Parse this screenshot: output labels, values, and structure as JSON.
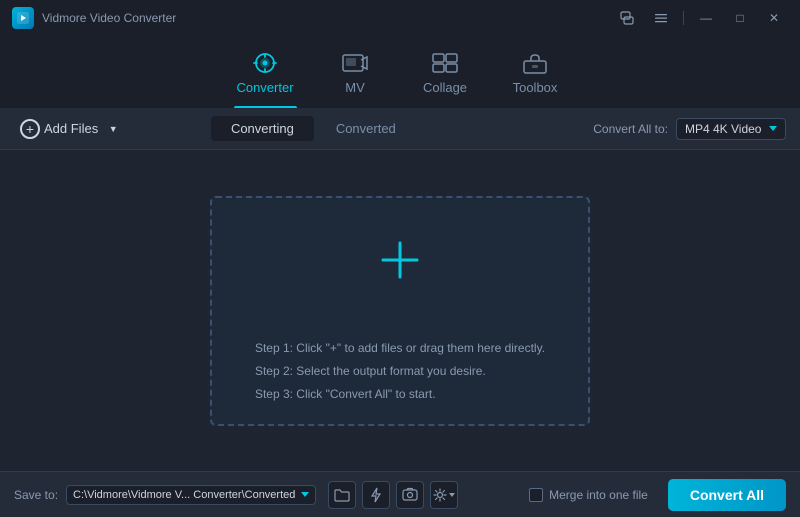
{
  "app": {
    "title": "Vidmore Video Converter",
    "logo_alt": "app-logo"
  },
  "title_bar": {
    "controls": {
      "chat_label": "💬",
      "menu_label": "≡",
      "separator": "|",
      "minimize_label": "—",
      "maximize_label": "□",
      "close_label": "✕"
    }
  },
  "nav": {
    "tabs": [
      {
        "id": "converter",
        "label": "Converter",
        "active": true
      },
      {
        "id": "mv",
        "label": "MV",
        "active": false
      },
      {
        "id": "collage",
        "label": "Collage",
        "active": false
      },
      {
        "id": "toolbox",
        "label": "Toolbox",
        "active": false
      }
    ]
  },
  "toolbar": {
    "add_files_label": "Add Files",
    "converting_tab": "Converting",
    "converted_tab": "Converted",
    "convert_all_to_label": "Convert All to:",
    "format_value": "MP4 4K Video"
  },
  "drop_zone": {
    "plus_icon": "+",
    "instructions": [
      "Step 1: Click \"+\" to add files or drag them here directly.",
      "Step 2: Select the output format you desire.",
      "Step 3: Click \"Convert All\" to start."
    ]
  },
  "bottom_bar": {
    "save_to_label": "Save to:",
    "save_path": "C:\\Vidmore\\Vidmore V... Converter\\Converted",
    "merge_label": "Merge into one file",
    "convert_all_label": "Convert All"
  }
}
